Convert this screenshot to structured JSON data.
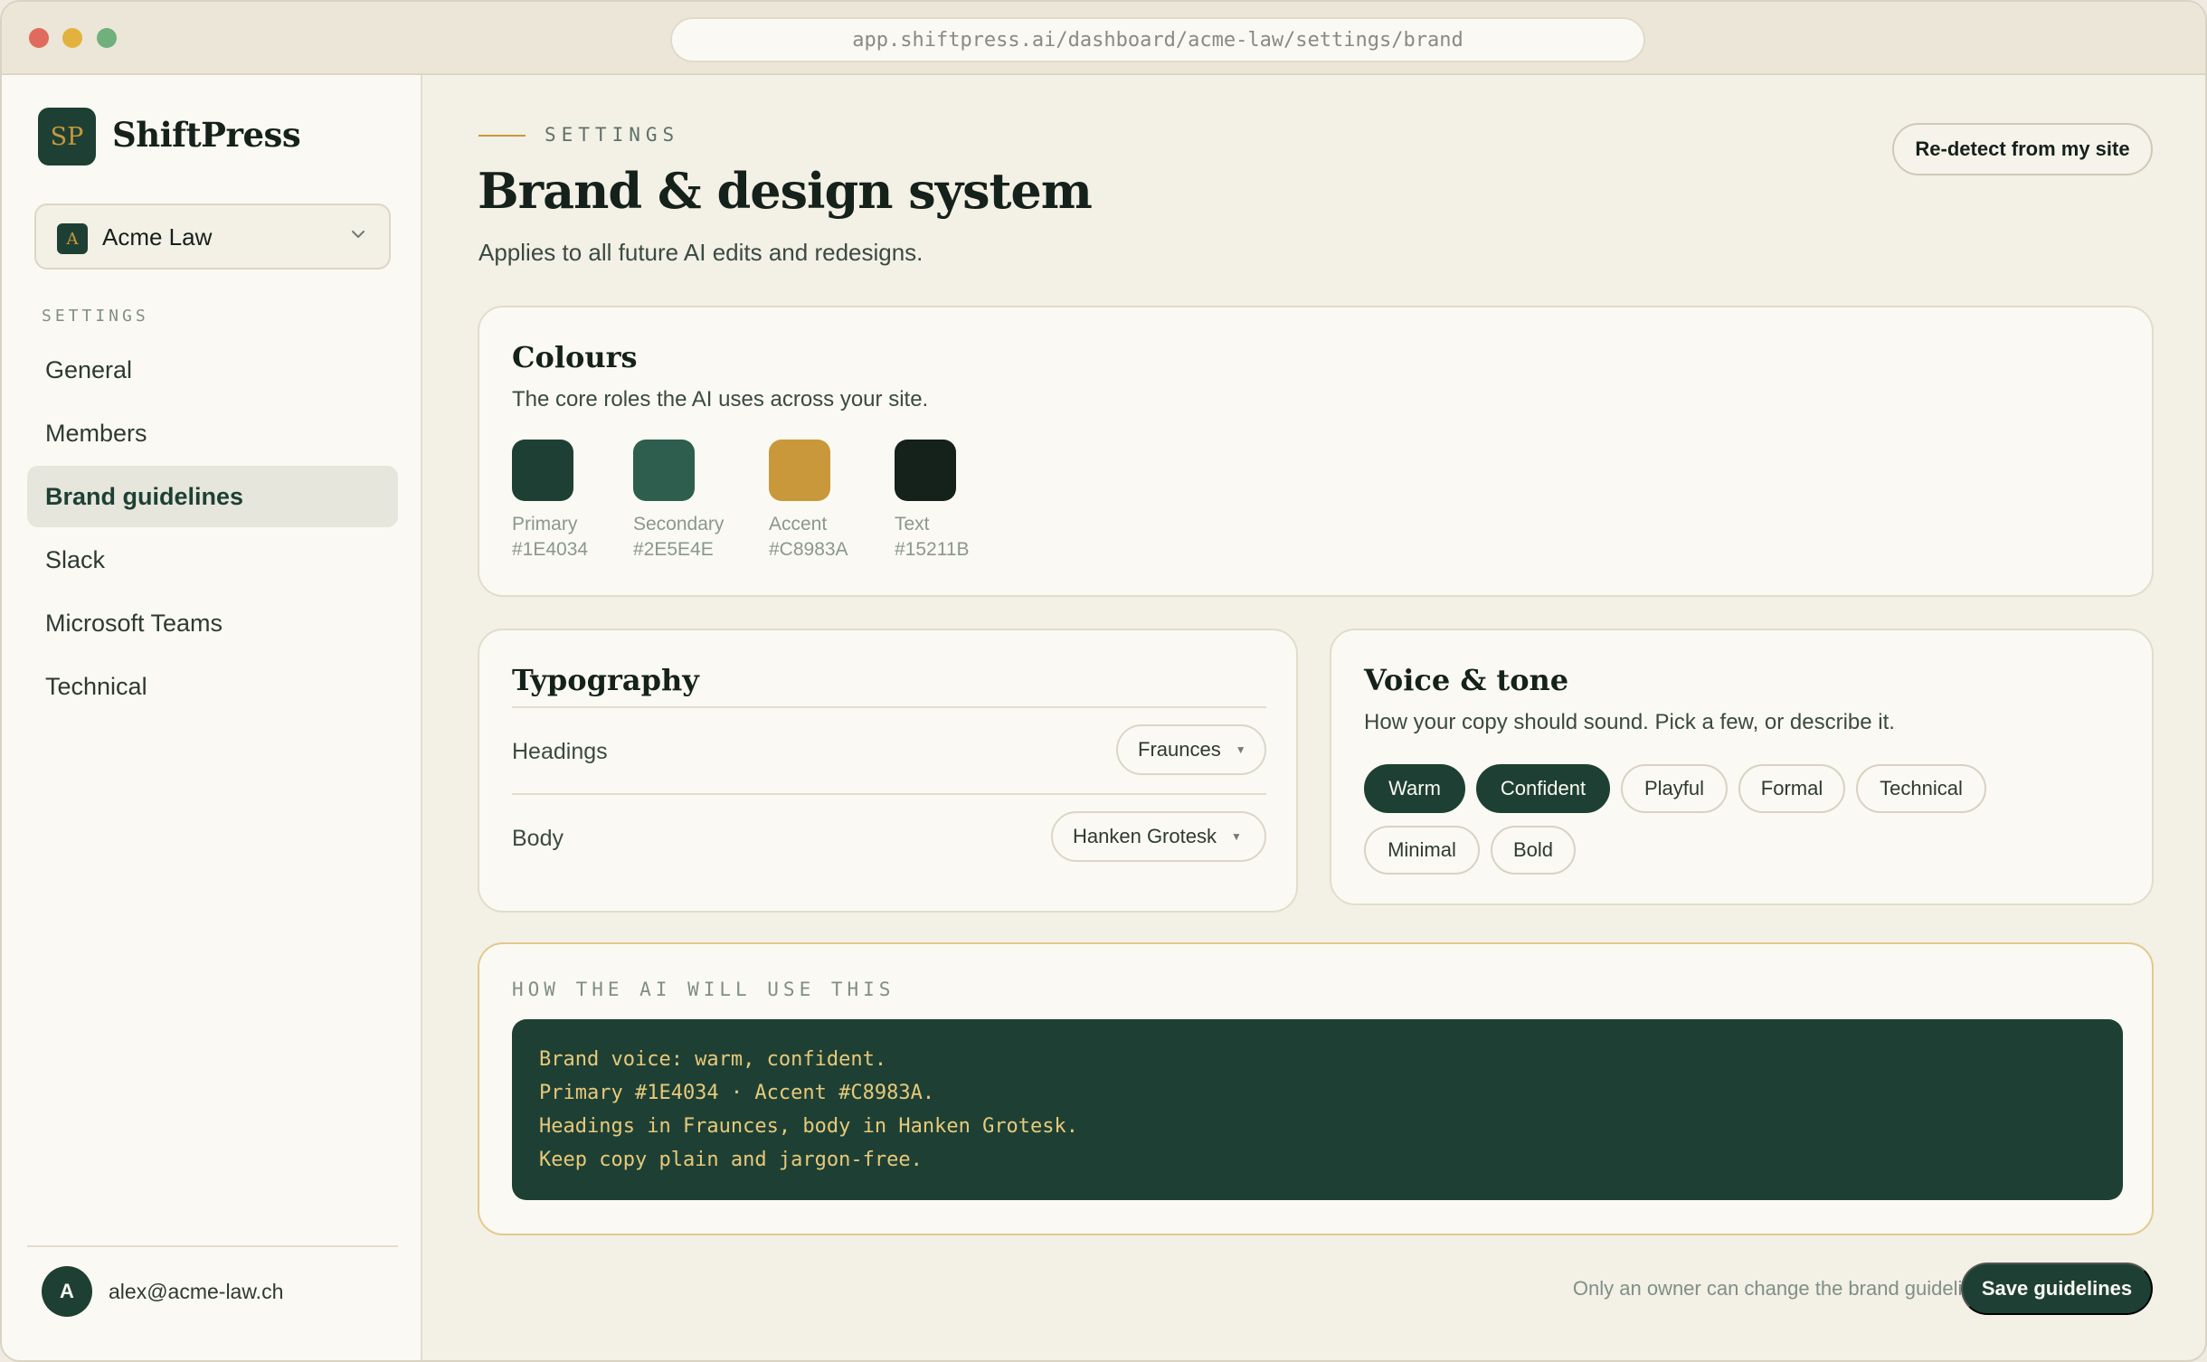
{
  "browser": {
    "url": "app.shiftpress.ai/dashboard/acme-law/settings/brand"
  },
  "sidebar": {
    "logo_mark": "SP",
    "app_name": "ShiftPress",
    "workspace": {
      "initial": "A",
      "name": "Acme Law"
    },
    "section_label": "SETTINGS",
    "items": [
      {
        "label": "General",
        "active": false
      },
      {
        "label": "Members",
        "active": false
      },
      {
        "label": "Brand guidelines",
        "active": true
      },
      {
        "label": "Slack",
        "active": false
      },
      {
        "label": "Microsoft Teams",
        "active": false
      },
      {
        "label": "Technical",
        "active": false
      }
    ],
    "user": {
      "initial": "A",
      "email": "alex@acme-law.ch"
    }
  },
  "header": {
    "eyebrow": "SETTINGS",
    "title": "Brand & design system",
    "subtitle": "Applies to all future AI edits and redesigns.",
    "redetect_label": "Re-detect from my site"
  },
  "colours": {
    "title": "Colours",
    "subtitle": "The core roles the AI uses across your site.",
    "swatches": [
      {
        "role": "Primary",
        "hex": "#1E4034",
        "color": "#1E4034"
      },
      {
        "role": "Secondary",
        "hex": "#2E5E4E",
        "color": "#2E5E4E"
      },
      {
        "role": "Accent",
        "hex": "#C8983A",
        "color": "#C8983A"
      },
      {
        "role": "Text",
        "hex": "#15211B",
        "color": "#15211B"
      }
    ]
  },
  "typography": {
    "title": "Typography",
    "rows": [
      {
        "label": "Headings",
        "value": "Fraunces"
      },
      {
        "label": "Body",
        "value": "Hanken Grotesk"
      }
    ]
  },
  "voice": {
    "title": "Voice & tone",
    "subtitle": "How your copy should sound. Pick a few, or describe it.",
    "chips": [
      {
        "label": "Warm",
        "selected": true
      },
      {
        "label": "Confident",
        "selected": true
      },
      {
        "label": "Playful",
        "selected": false
      },
      {
        "label": "Formal",
        "selected": false
      },
      {
        "label": "Technical",
        "selected": false
      },
      {
        "label": "Minimal",
        "selected": false
      },
      {
        "label": "Bold",
        "selected": false
      }
    ]
  },
  "prompt": {
    "eyebrow": "HOW THE AI WILL USE THIS",
    "lines": [
      "Brand voice: warm, confident.",
      "Primary #1E4034 · Accent #C8983A.",
      "Headings in Fraunces, body in Hanken Grotesk.",
      "Keep copy plain and jargon-free."
    ]
  },
  "footer": {
    "note": "Only an owner can change the brand guidelines.",
    "save_label": "Save guidelines"
  }
}
